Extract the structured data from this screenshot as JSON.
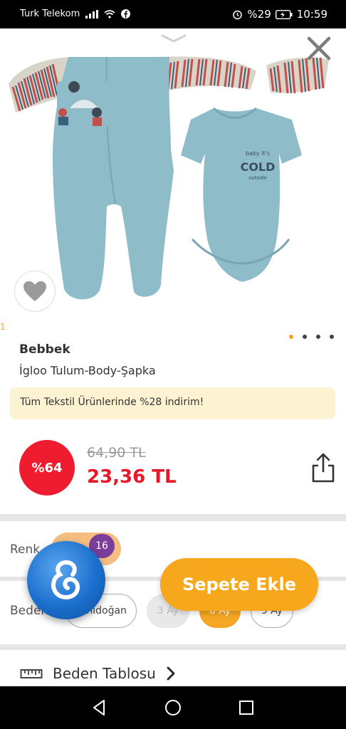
{
  "status_bar": {
    "carrier": "Turk Telekom",
    "battery": "%29",
    "time": "10:59"
  },
  "product": {
    "brand": "Bebbek",
    "name": "İgloo Tulum-Body-Şapka",
    "promo": "Tüm Tekstil Ürünlerinde %28 indirim!",
    "discount_badge": "%64",
    "old_price": "64,90 TL",
    "new_price": "23,36 TL",
    "image_index_total": 4,
    "image_index_active": 1,
    "print_text_top": "baby it's",
    "print_text_main": "COLD",
    "print_text_bottom": "outside",
    "edge_mark": "1"
  },
  "options": {
    "color_label": "Renk",
    "color_count": "16",
    "size_label": "Beden",
    "sizes": [
      {
        "label": "Yenidoğan",
        "state": "available"
      },
      {
        "label": "3 Ay",
        "state": "disabled"
      },
      {
        "label": "6 Ay",
        "state": "selected"
      },
      {
        "label": "9 Ay",
        "state": "available"
      }
    ]
  },
  "actions": {
    "add_to_cart": "Sepete Ekle",
    "size_table": "Beden Tablosu"
  },
  "colors": {
    "accent": "#f7a71b",
    "price_red": "#e8182b",
    "badge_red": "#ee1c2e",
    "promo_bg": "#fdf3d2",
    "garment": "#8fbcc9"
  },
  "icons": {
    "close": "close-icon",
    "collapse": "chevron-down-icon",
    "favorite": "heart-icon",
    "share": "share-icon",
    "ruler": "ruler-icon",
    "arrow": "chevron-right-icon"
  }
}
